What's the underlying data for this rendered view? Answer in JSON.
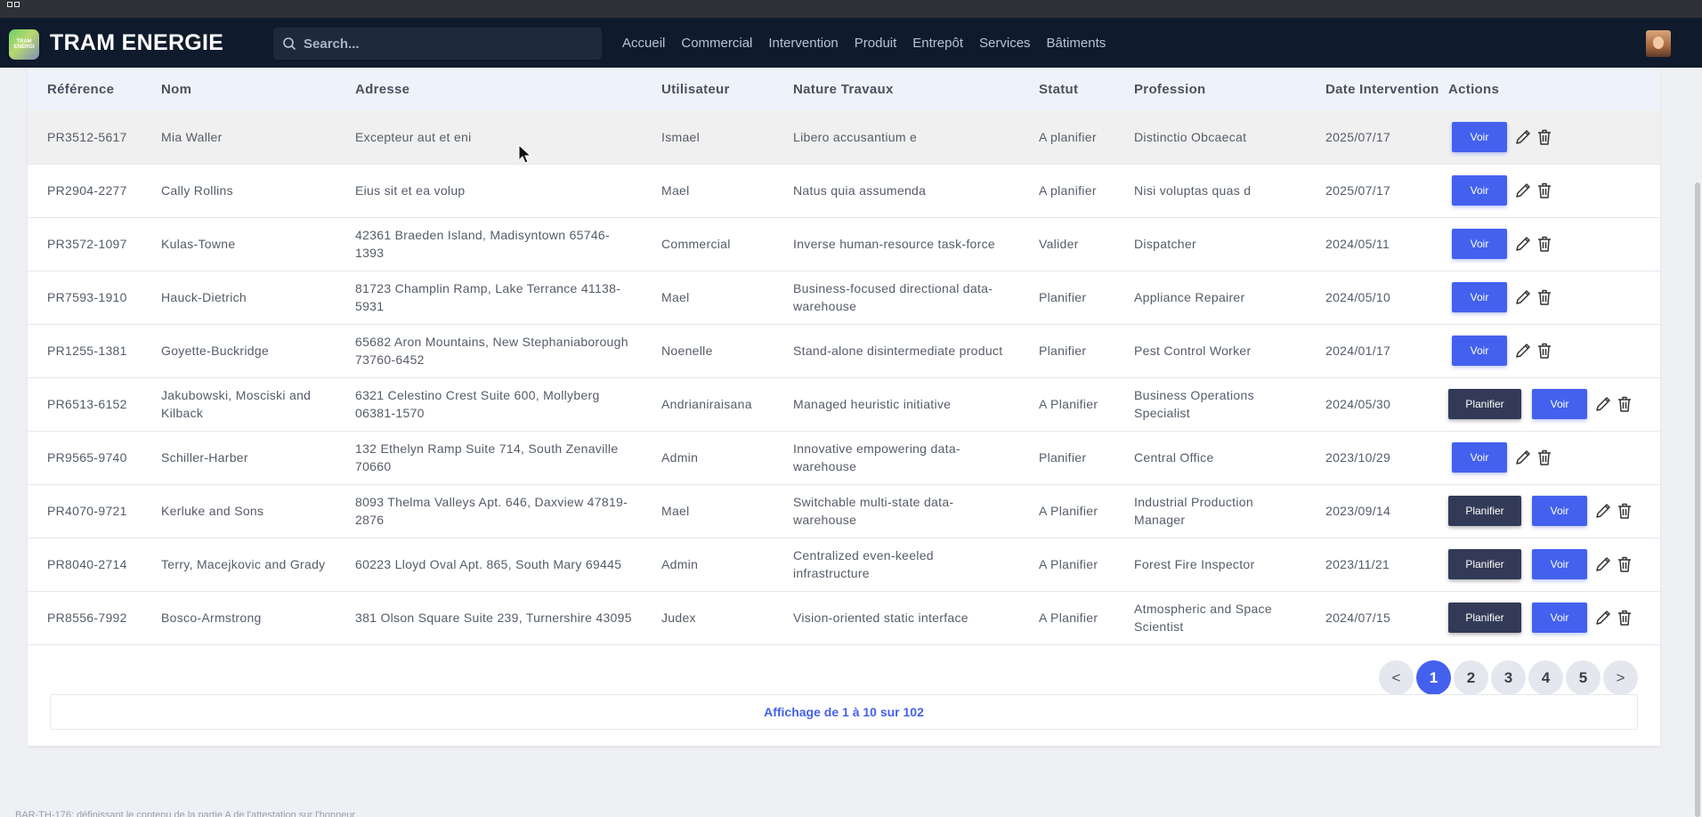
{
  "app": {
    "brand": "TRAM ENERGIE",
    "logo_text": "TRAM ENERGI"
  },
  "search": {
    "placeholder": "Search..."
  },
  "nav": [
    "Accueil",
    "Commercial",
    "Intervention",
    "Produit",
    "Entrepôt",
    "Services",
    "Bâtiments"
  ],
  "table": {
    "headers": {
      "reference": "Référence",
      "nom": "Nom",
      "adresse": "Adresse",
      "utilisateur": "Utilisateur",
      "nature": "Nature Travaux",
      "statut": "Statut",
      "profession": "Profession",
      "date": "Date Intervention",
      "actions": "Actions"
    },
    "rows": [
      {
        "ref": "PR3512-5617",
        "nom": "Mia Waller",
        "adresse": "Excepteur aut et eni",
        "user": "Ismael",
        "nature": "Libero accusantium e",
        "statut": "A planifier",
        "profession": "Distinctio Obcaecat",
        "date": "2025/07/17",
        "planifier": false
      },
      {
        "ref": "PR2904-2277",
        "nom": "Cally Rollins",
        "adresse": "Eius sit et ea volup",
        "user": "Mael",
        "nature": "Natus quia assumenda",
        "statut": "A planifier",
        "profession": "Nisi voluptas quas d",
        "date": "2025/07/17",
        "planifier": false
      },
      {
        "ref": "PR3572-1097",
        "nom": "Kulas-Towne",
        "adresse": "42361 Braeden Island, Madisyntown 65746-1393",
        "user": "Commercial",
        "nature": "Inverse human-resource task-force",
        "statut": "Valider",
        "profession": "Dispatcher",
        "date": "2024/05/11",
        "planifier": false
      },
      {
        "ref": "PR7593-1910",
        "nom": "Hauck-Dietrich",
        "adresse": "81723 Champlin Ramp, Lake Terrance 41138-5931",
        "user": "Mael",
        "nature": "Business-focused directional data-warehouse",
        "statut": "Planifier",
        "profession": "Appliance Repairer",
        "date": "2024/05/10",
        "planifier": false
      },
      {
        "ref": "PR1255-1381",
        "nom": "Goyette-Buckridge",
        "adresse": "65682 Aron Mountains, New Stephaniaborough 73760-6452",
        "user": "Noenelle",
        "nature": "Stand-alone disintermediate product",
        "statut": "Planifier",
        "profession": "Pest Control Worker",
        "date": "2024/01/17",
        "planifier": false
      },
      {
        "ref": "PR6513-6152",
        "nom": "Jakubowski, Mosciski and Kilback",
        "adresse": "6321 Celestino Crest Suite 600, Mollyberg 06381-1570",
        "user": "Andrianiraisana",
        "nature": "Managed heuristic initiative",
        "statut": "A Planifier",
        "profession": "Business Operations Specialist",
        "date": "2024/05/30",
        "planifier": true
      },
      {
        "ref": "PR9565-9740",
        "nom": "Schiller-Harber",
        "adresse": "132 Ethelyn Ramp Suite 714, South Zenaville 70660",
        "user": "Admin",
        "nature": "Innovative empowering data-warehouse",
        "statut": "Planifier",
        "profession": "Central Office",
        "date": "2023/10/29",
        "planifier": false
      },
      {
        "ref": "PR4070-9721",
        "nom": "Kerluke and Sons",
        "adresse": "8093 Thelma Valleys Apt. 646, Daxview 47819-2876",
        "user": "Mael",
        "nature": "Switchable multi-state data-warehouse",
        "statut": "A Planifier",
        "profession": "Industrial Production Manager",
        "date": "2023/09/14",
        "planifier": true
      },
      {
        "ref": "PR8040-2714",
        "nom": "Terry, Macejkovic and Grady",
        "adresse": "60223 Lloyd Oval Apt. 865, South Mary 69445",
        "user": "Admin",
        "nature": "Centralized even-keeled infrastructure",
        "statut": "A Planifier",
        "profession": "Forest Fire Inspector",
        "date": "2023/11/21",
        "planifier": true
      },
      {
        "ref": "PR8556-7992",
        "nom": "Bosco-Armstrong",
        "adresse": "381 Olson Square Suite 239, Turnershire 43095",
        "user": "Judex",
        "nature": "Vision-oriented static interface",
        "statut": "A Planifier",
        "profession": "Atmospheric and Space Scientist",
        "date": "2024/07/15",
        "planifier": true
      }
    ],
    "voir_label": "Voir",
    "planifier_label": "Planifier"
  },
  "pagination": {
    "prev": "<",
    "next": ">",
    "pages": [
      "1",
      "2",
      "3",
      "4",
      "5"
    ],
    "active": "1",
    "summary": "Affichage de 1 à 10 sur 102"
  },
  "footer": {
    "text": "BAR-TH-176: définissant le contenu de la partie A de l'attestation sur l'honneur"
  },
  "colors": {
    "accent": "#4361ee",
    "dark_button": "#323a57",
    "nav_bg": "#0f1b2d"
  }
}
